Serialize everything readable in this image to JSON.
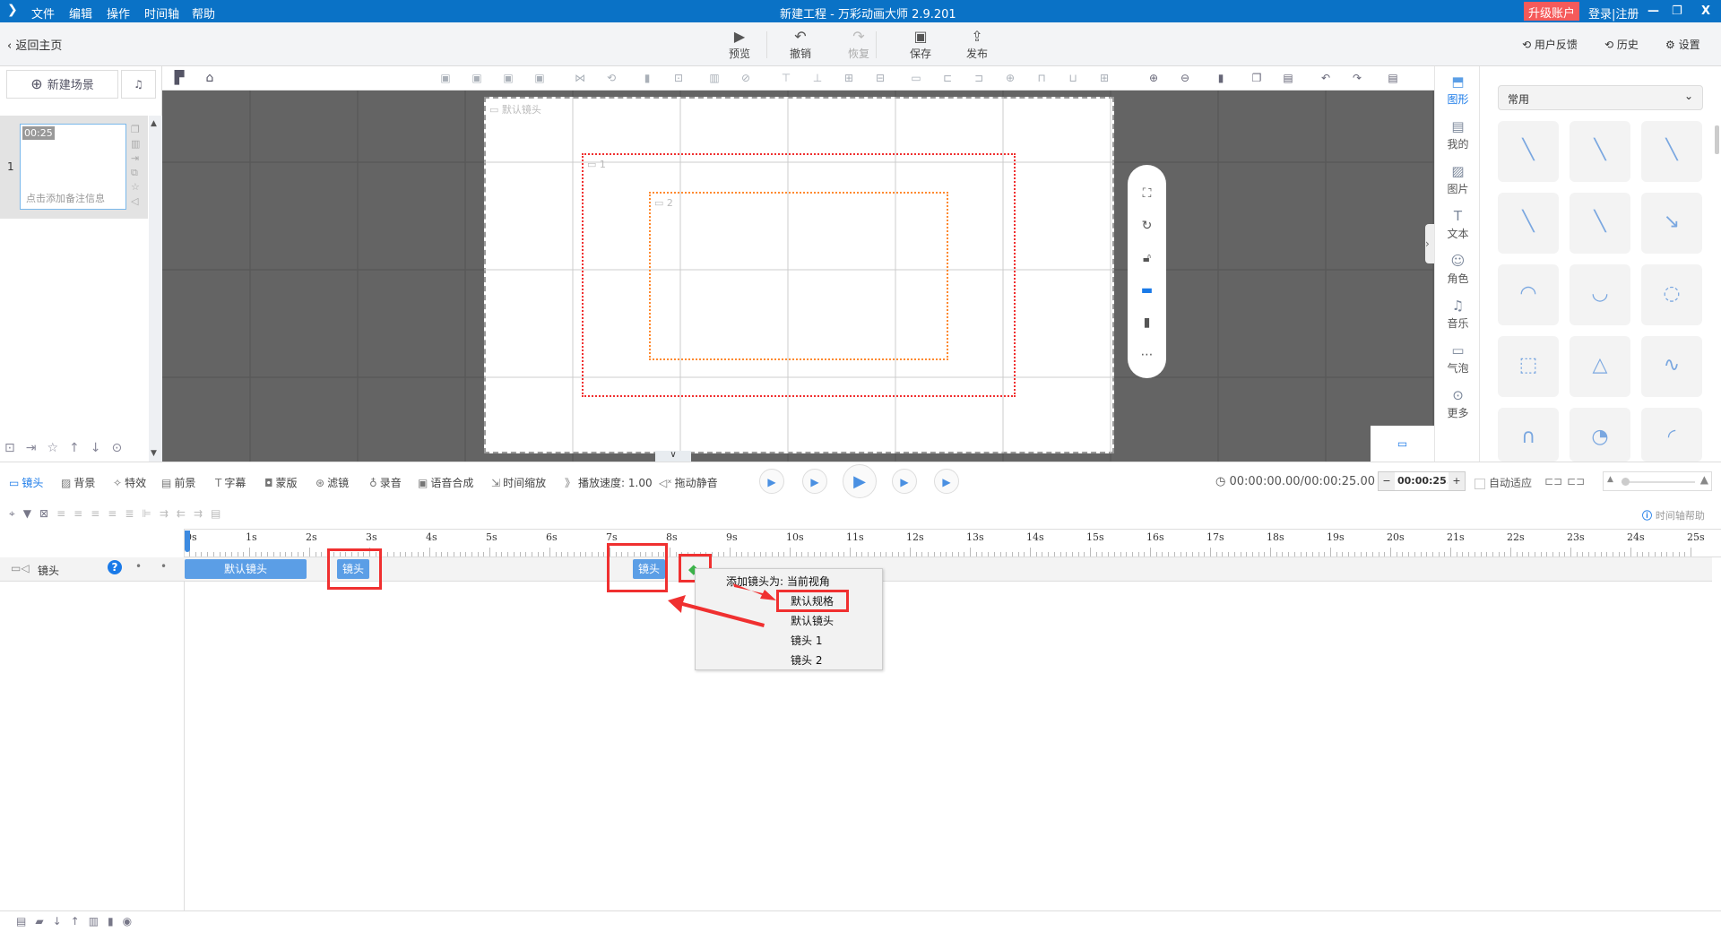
{
  "titlebar": {
    "menu": [
      "文件",
      "编辑",
      "操作",
      "时间轴",
      "帮助"
    ],
    "title": "新建工程 - 万彩动画大师 2.9.201",
    "upgrade": "升级账户",
    "login": "登录|注册",
    "accent": "#0a72c6",
    "upgrade_color": "#f55a5a"
  },
  "toolbar": {
    "back": "返回主页",
    "buttons": [
      {
        "label": "预览",
        "icon": "play-icon"
      },
      {
        "label": "撤销",
        "icon": "undo-icon"
      },
      {
        "label": "恢复",
        "icon": "redo-icon"
      },
      {
        "label": "保存",
        "icon": "save-icon"
      },
      {
        "label": "发布",
        "icon": "publish-icon"
      }
    ],
    "feedback": "用户反馈",
    "history": "历史",
    "settings": "设置"
  },
  "leftpanel": {
    "new_scene": "新建场景",
    "scene_number": "1",
    "scene_duration": "00:25",
    "scene_note": "点击添加备注信息"
  },
  "canvas": {
    "default_camera": "默认镜头",
    "camera1": "1",
    "camera2": "2",
    "camera1_color": "#f03030",
    "camera2_color": "#ff8a30"
  },
  "rightcol": {
    "items": [
      "图形",
      "我的",
      "图片",
      "文本",
      "角色",
      "音乐",
      "气泡",
      "更多"
    ]
  },
  "rightpanel": {
    "category": "常用"
  },
  "bottombar": {
    "tracks": [
      "镜头",
      "背景",
      "特效",
      "前景",
      "字幕",
      "蒙版",
      "滤镜",
      "录音",
      "语音合成",
      "时间缩放",
      "播放速度: 1.00",
      "拖动静音"
    ],
    "time": "00:00:00.00/00:00:25.00",
    "duration": "00:00:25.0",
    "minus": "−",
    "plus": "+",
    "auto_fit": "自动适应",
    "help": "时间轴帮助"
  },
  "ruler": {
    "labels": [
      "0s",
      "1s",
      "2s",
      "3s",
      "4s",
      "5s",
      "6s",
      "7s",
      "8s",
      "9s",
      "10s",
      "11s",
      "12s",
      "13s",
      "14s",
      "15s",
      "16s",
      "17s",
      "18s",
      "19s",
      "20s",
      "21s",
      "22s",
      "23s",
      "24s",
      "25s"
    ]
  },
  "track": {
    "name": "镜头",
    "clips": [
      "默认镜头",
      "镜头",
      "镜头"
    ]
  },
  "contextmenu": {
    "header": "添加镜头为: 当前视角",
    "items": [
      "默认规格",
      "默认镜头",
      "镜头 1",
      "镜头 2"
    ]
  }
}
